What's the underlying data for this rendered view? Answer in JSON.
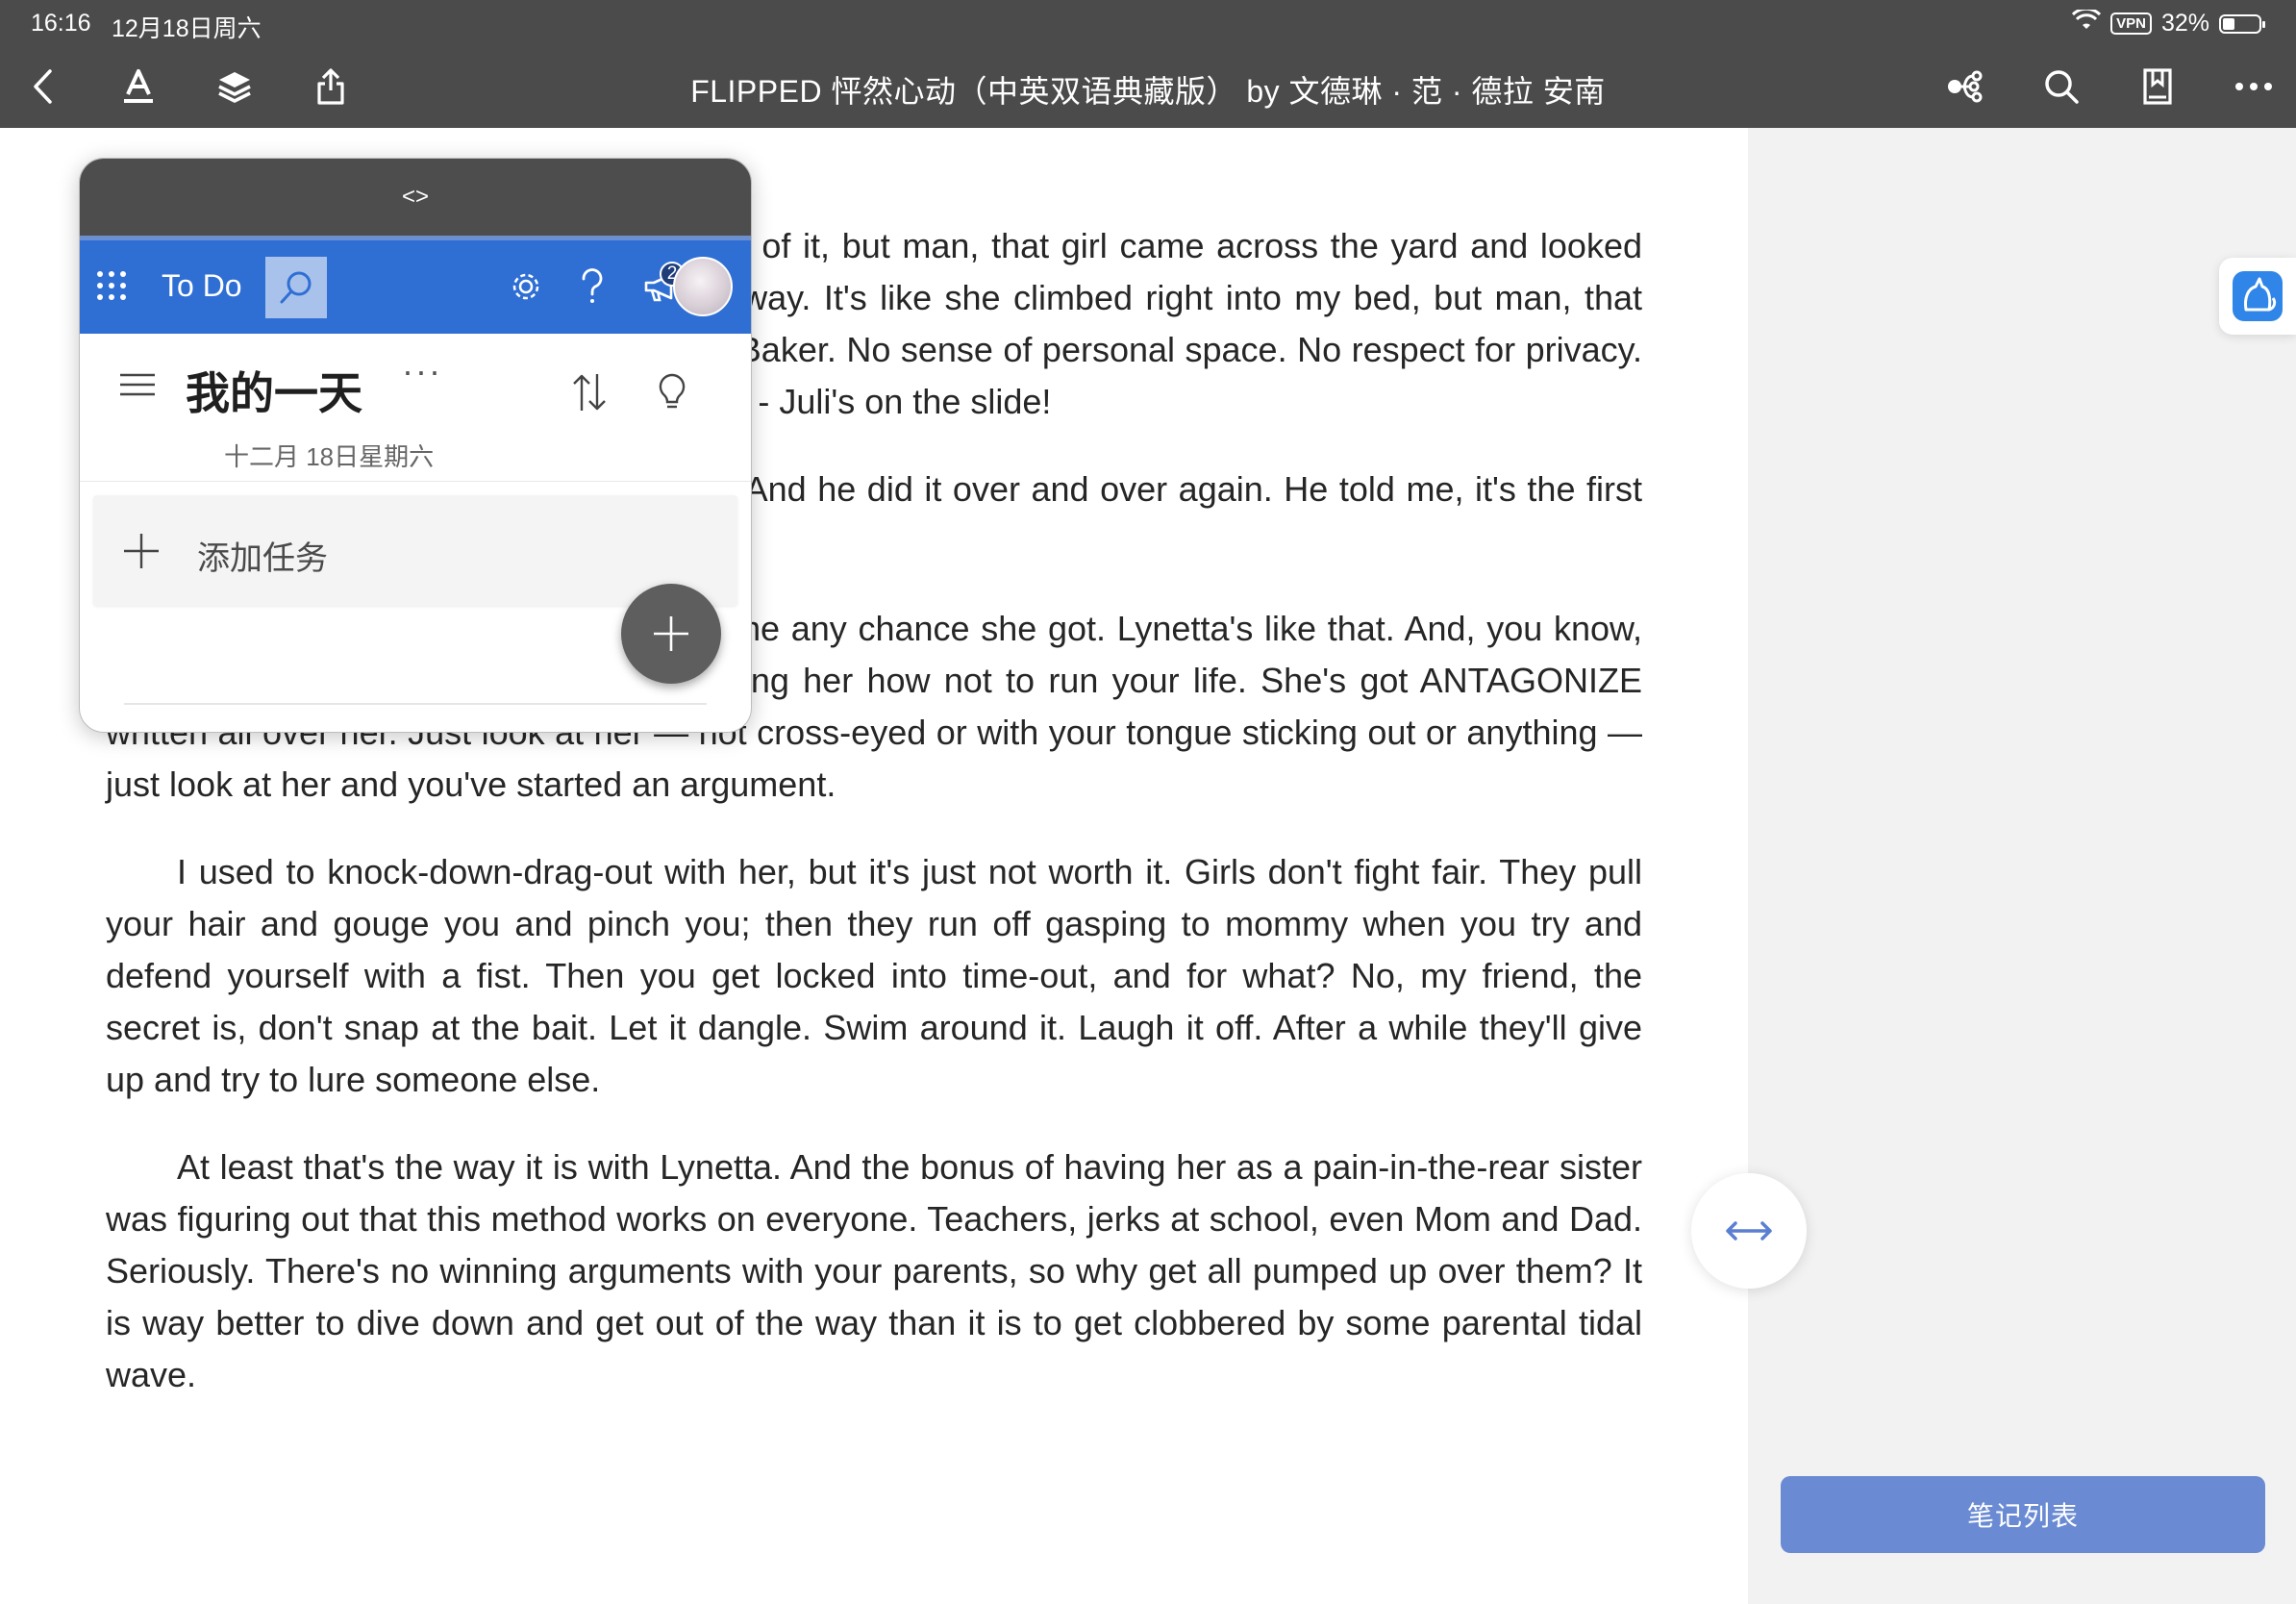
{
  "status_bar": {
    "time": "16:16",
    "date": "12月18日周六",
    "vpn": "VPN",
    "battery": "32%",
    "battery_level": 0.32
  },
  "toolbar": {
    "book_title": "FLIPPED 怦然心动（中英双语典藏版） by 文德琳 · 范 · 德拉  安南",
    "icons": [
      "back-icon",
      "text-style-icon",
      "layers-icon",
      "share-icon",
      "mind-map-icon",
      "search-icon",
      "bookmark-icon",
      "more-icon"
    ]
  },
  "book": {
    "paragraphs": [
      {
        "indent": false,
        "text": "My mother says we're too polite to speak of it, but man, that girl came across the yard and looked through my window. I spotted her right away. It's like she climbed right into my bed, but man, that right there tells you something about Juli Baker. No sense of personal space. No respect for privacy. The world is her playground. And she was - Juli's on the slide!"
      },
      {
        "indent": true,
        "text": "My dad taught me how to run block. And he did it over and over again. He told me, it's the first thing he's gone.He was a lifesaver."
      },
      {
        "indent": true,
        "text": "My sister Lynetta used to sabotage me any chance she got. Lynetta's like that. And, you know, she's my buddy, I've learned from watching her how not to run your life. She's got ANTAGONIZE written all over her. Just look at her — not cross-eyed or with your tongue sticking out or anything — just look at her and you've started an argument."
      },
      {
        "indent": true,
        "text": "I used to knock-down-drag-out with her, but it's just not worth it. Girls don't fight fair. They pull your hair and gouge you and pinch you; then they run off gasping to mommy when you try and defend yourself with a fist. Then you get locked into time-out, and for what? No, my friend, the secret is, don't snap at the bait. Let it dangle. Swim around it. Laugh it off. After a while they'll give up and try to lure someone else."
      },
      {
        "indent": true,
        "text": "At least that's the way it is with Lynetta. And the bonus of having her as a pain-in-the-rear sister was figuring out that this method works on everyone. Teachers, jerks at school, even Mom and Dad. Seriously. There's no winning arguments with your parents, so why get all pumped up over them? It is way better to dive down and get out of the way than it is to get clobbered by some parental tidal wave."
      }
    ]
  },
  "side_panel": {
    "notes_button": "笔记列表",
    "swap_icon": "swap-horizontal-icon",
    "helper_icon": "cat-assistant-icon"
  },
  "todo": {
    "grip": "<>",
    "app_name": "To Do",
    "notification_count": "2",
    "list_title": "我的一天",
    "list_more": "···",
    "list_date": "十二月 18日星期六",
    "add_task": "添加任务",
    "colors": {
      "header": "#2f6fd4",
      "grip": "#4d4d4d"
    }
  }
}
